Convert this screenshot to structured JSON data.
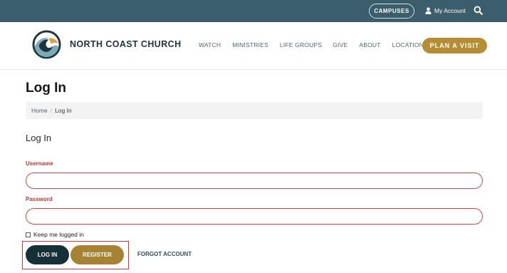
{
  "topbar": {
    "campuses_label": "CAMPUSES",
    "account_label": "My Account",
    "bg_color": "#3a5e6b"
  },
  "header": {
    "brand": "NORTH COAST CHURCH",
    "nav": [
      "WATCH",
      "MINISTRIES",
      "LIFE GROUPS",
      "GIVE",
      "ABOUT",
      "LOCATIONS"
    ],
    "cta_label": "PLAN A VISIT",
    "accent_color": "#b68d32"
  },
  "page": {
    "title": "Log In",
    "breadcrumb": {
      "home": "Home",
      "current": "Log In"
    }
  },
  "form": {
    "section_title": "Log In",
    "username_label": "Username",
    "username_value": "",
    "password_label": "Password",
    "password_value": "",
    "remember_label": "Keep me logged in",
    "remember_checked": false,
    "login_label": "LOG IN",
    "register_label": "REGISTER",
    "forgot_label": "FORGOT ACCOUNT",
    "label_color": "#b23a36"
  },
  "icons": [
    "user-icon",
    "search-icon",
    "wave-logo-icon",
    "checkbox-icon"
  ]
}
